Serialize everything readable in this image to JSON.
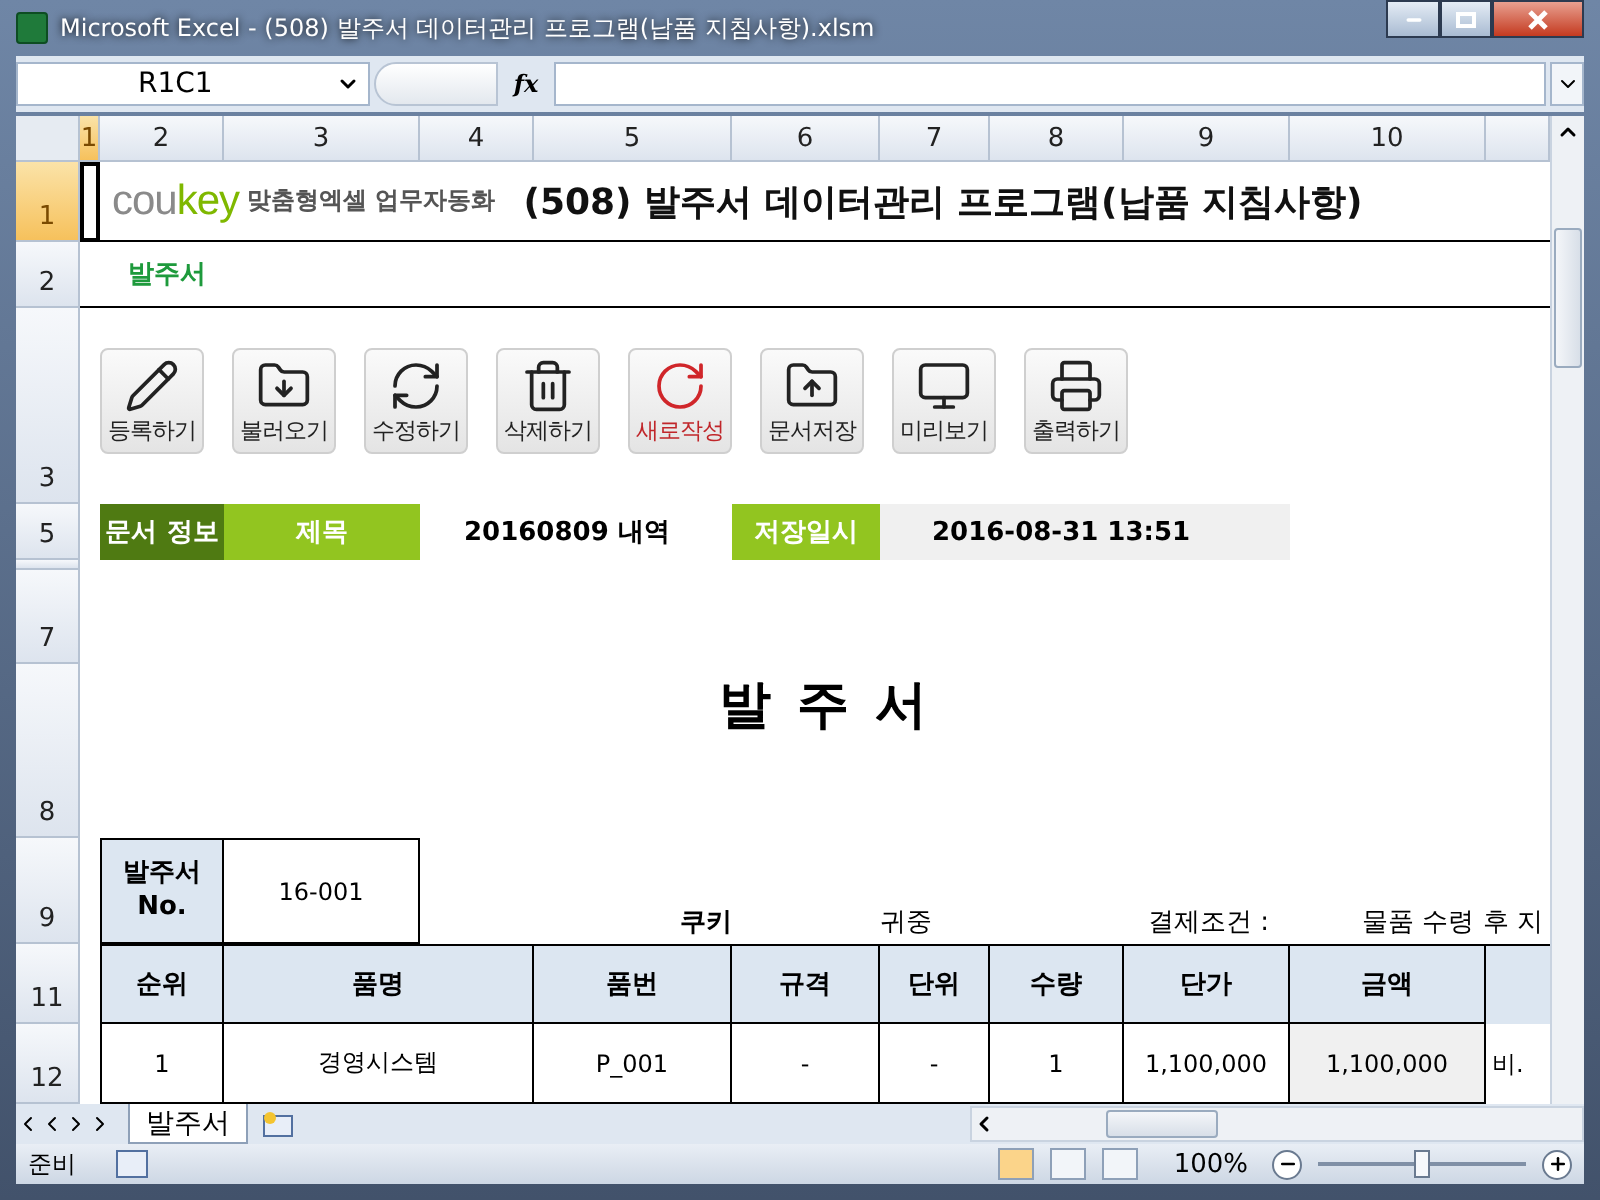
{
  "window": {
    "title": "Microsoft Excel - (508) 발주서 데이터관리 프로그램(납품 지침사항).xlsm"
  },
  "formula_bar": {
    "name_box": "R1C1",
    "fx": "fx"
  },
  "column_headers": [
    {
      "label": "1",
      "selected": true
    },
    {
      "label": "2",
      "selected": false
    },
    {
      "label": "3",
      "selected": false
    },
    {
      "label": "4",
      "selected": false
    },
    {
      "label": "5",
      "selected": false
    },
    {
      "label": "6",
      "selected": false
    },
    {
      "label": "7",
      "selected": false
    },
    {
      "label": "8",
      "selected": false
    },
    {
      "label": "9",
      "selected": false
    },
    {
      "label": "10",
      "selected": false
    }
  ],
  "row_headers": [
    {
      "label": "1",
      "selected": true
    },
    {
      "label": "2",
      "selected": false
    },
    {
      "label": "3",
      "selected": false
    },
    {
      "label": "5",
      "selected": false
    },
    {
      "label": "7",
      "selected": false
    },
    {
      "label": "8",
      "selected": false
    },
    {
      "label": "9",
      "selected": false
    },
    {
      "label": "11",
      "selected": false
    },
    {
      "label": "12",
      "selected": false
    }
  ],
  "logo": {
    "brand": [
      "cou",
      "key"
    ],
    "tagline": "맞춤형엑셀 업무자동화"
  },
  "title": "(508) 발주서 데이터관리 프로그램(납품 지침사항)",
  "sheet_label": "발주서",
  "buttons": [
    {
      "label": "등록하기",
      "kind": "pencil",
      "highlighted": false
    },
    {
      "label": "불러오기",
      "kind": "load",
      "highlighted": false
    },
    {
      "label": "수정하기",
      "kind": "refresh",
      "highlighted": false
    },
    {
      "label": "삭제하기",
      "kind": "trash",
      "highlighted": false
    },
    {
      "label": "새로작성",
      "kind": "new",
      "highlighted": true
    },
    {
      "label": "문서저장",
      "kind": "save",
      "highlighted": false
    },
    {
      "label": "미리보기",
      "kind": "preview",
      "highlighted": false
    },
    {
      "label": "출력하기",
      "kind": "print",
      "highlighted": false
    }
  ],
  "doc_info": {
    "section": "문서 정보",
    "title_label": "제목",
    "title_value": "20160809 내역",
    "saved_label": "저장일시",
    "saved_value": "2016-08-31 13:51"
  },
  "form_title": "발 주 서",
  "po_no": {
    "label": "발주서 No.",
    "value": "16-001"
  },
  "recipient": "쿠키",
  "honorific": "귀중",
  "payment_label": "결제조건 :",
  "payment_value": "물품 수령 후 지",
  "table": {
    "columns": [
      "순위",
      "품명",
      "품번",
      "규격",
      "단위",
      "수량",
      "단가",
      "금액"
    ],
    "rows": [
      {
        "cells": [
          "1",
          "경영시스템",
          "P_001",
          "-",
          "-",
          "1",
          "1,100,000",
          "1,100,000",
          "비."
        ]
      }
    ]
  },
  "sheet_tabs": [
    {
      "label": "발주서",
      "selected": true
    }
  ],
  "status_bar": {
    "text": "준비",
    "zoom": "100%",
    "level": 0.5
  }
}
